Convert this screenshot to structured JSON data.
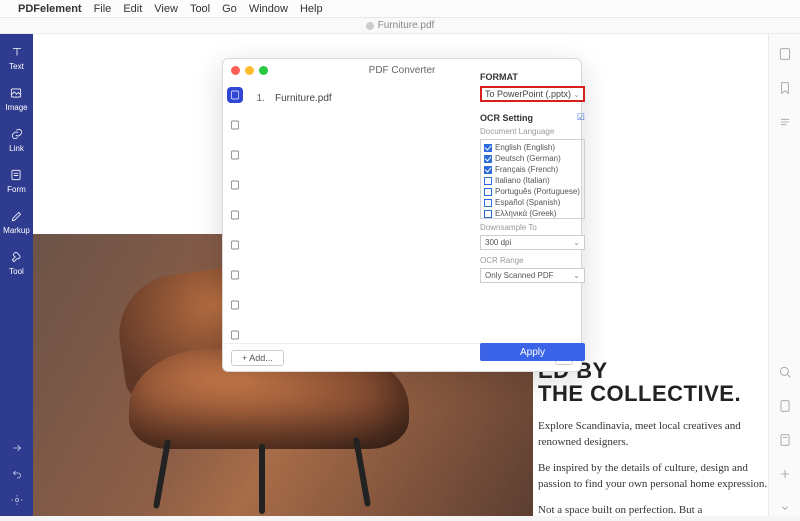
{
  "menubar": {
    "app": "PDFelement",
    "items": [
      "File",
      "Edit",
      "View",
      "Tool",
      "Go",
      "Window",
      "Help"
    ]
  },
  "window": {
    "doc_title": "Furniture.pdf"
  },
  "leftbar": {
    "items": [
      {
        "name": "text",
        "label": "Text"
      },
      {
        "name": "image",
        "label": "Image"
      },
      {
        "name": "link",
        "label": "Link"
      },
      {
        "name": "form",
        "label": "Form"
      },
      {
        "name": "markup",
        "label": "Markup"
      },
      {
        "name": "tool",
        "label": "Tool"
      }
    ]
  },
  "document": {
    "heading_line1": "ED BY",
    "heading_line2": "THE COLLECTIVE.",
    "para1": "Explore Scandinavia, meet local creatives and renowned designers.",
    "para2": "Be inspired by the details of culture, design and passion to find your own personal home expression.",
    "para3": "Not a space built on perfection. But a"
  },
  "dialog": {
    "title": "PDF Converter",
    "files": [
      {
        "idx": "1.",
        "name": "Furniture.pdf"
      }
    ],
    "add_label": "+  Add..."
  },
  "settings": {
    "format_label": "FORMAT",
    "format_value": "To PowerPoint (.pptx)",
    "ocr_label": "OCR Setting",
    "doclang_label": "Document Language",
    "languages": [
      {
        "label": "English (English)",
        "checked": true
      },
      {
        "label": "Deutsch (German)",
        "checked": true
      },
      {
        "label": "Français (French)",
        "checked": true
      },
      {
        "label": "Italiano (Italian)",
        "checked": false
      },
      {
        "label": "Português (Portuguese)",
        "checked": false
      },
      {
        "label": "Español (Spanish)",
        "checked": false
      },
      {
        "label": "Ελληνικά (Greek)",
        "checked": false
      }
    ],
    "downsample_label": "Downsample To",
    "downsample_value": "300 dpi",
    "ocrrange_label": "OCR Range",
    "ocrrange_value": "Only Scanned PDF",
    "apply_label": "Apply"
  }
}
